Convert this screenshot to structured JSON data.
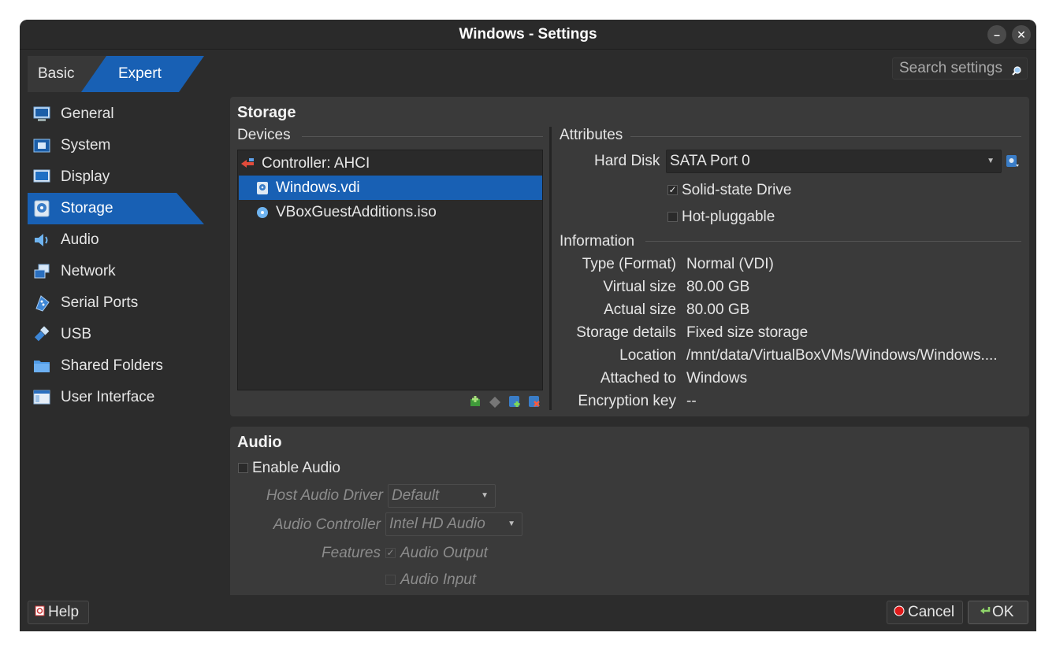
{
  "window": {
    "title": "Windows - Settings"
  },
  "mode": {
    "basic": "Basic",
    "expert": "Expert"
  },
  "search": {
    "placeholder": "Search settings"
  },
  "nav": {
    "items": [
      {
        "label": "General",
        "icon": "monitor-icon"
      },
      {
        "label": "System",
        "icon": "chip-icon"
      },
      {
        "label": "Display",
        "icon": "display-icon"
      },
      {
        "label": "Storage",
        "icon": "disk-icon",
        "active": true
      },
      {
        "label": "Audio",
        "icon": "speaker-icon"
      },
      {
        "label": "Network",
        "icon": "network-icon"
      },
      {
        "label": "Serial Ports",
        "icon": "serial-icon"
      },
      {
        "label": "USB",
        "icon": "usb-icon"
      },
      {
        "label": "Shared Folders",
        "icon": "folder-icon"
      },
      {
        "label": "User Interface",
        "icon": "window-icon"
      }
    ]
  },
  "storage": {
    "title": "Storage",
    "devices_label": "Devices",
    "tree": {
      "controller": "Controller: AHCI",
      "items": [
        "Windows.vdi",
        "VBoxGuestAdditions.iso"
      ]
    },
    "attributes_label": "Attributes",
    "hard_disk_label": "Hard Disk",
    "hard_disk_value": "SATA Port 0",
    "ssd_label": "Solid-state Drive",
    "hotplug_label": "Hot-pluggable",
    "information_label": "Information",
    "info": [
      {
        "key": "Type (Format)",
        "value": "Normal (VDI)"
      },
      {
        "key": "Virtual size",
        "value": "80.00 GB"
      },
      {
        "key": "Actual size",
        "value": "80.00 GB"
      },
      {
        "key": "Storage details",
        "value": "Fixed size storage"
      },
      {
        "key": "Location",
        "value": "/mnt/data/VirtualBoxVMs/Windows/Windows...."
      },
      {
        "key": "Attached to",
        "value": "Windows"
      },
      {
        "key": "Encryption key",
        "value": "--"
      }
    ]
  },
  "audio": {
    "title": "Audio",
    "enable_label": "Enable Audio",
    "host_driver_label": "Host Audio Driver",
    "host_driver_value": "Default",
    "controller_label": "Audio Controller",
    "controller_value": "Intel HD Audio",
    "features_label": "Features",
    "output_label": "Audio Output",
    "input_label": "Audio Input"
  },
  "footer": {
    "help": "Help",
    "cancel": "Cancel",
    "ok": "OK"
  },
  "colors": {
    "accent": "#1860b4",
    "background": "#2c2c2c",
    "panel": "#3a3a3a"
  }
}
